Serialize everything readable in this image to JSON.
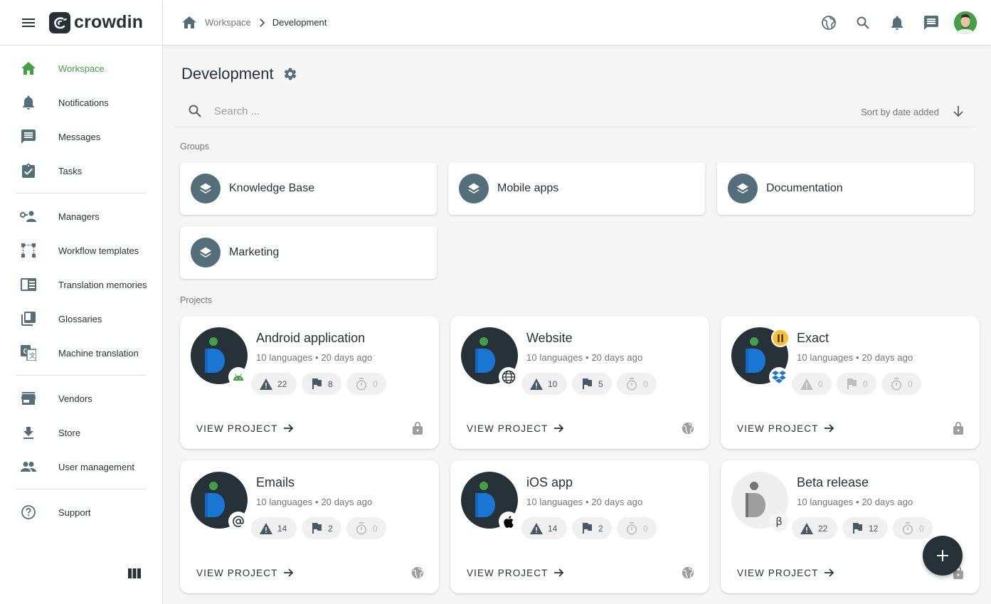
{
  "brand": {
    "name": "crowdin",
    "accent": "#43a047",
    "dark": "#263238"
  },
  "sidebar": {
    "items": [
      {
        "label": "Workspace",
        "icon": "home-icon",
        "active": true
      },
      {
        "label": "Notifications",
        "icon": "bell-icon"
      },
      {
        "label": "Messages",
        "icon": "message-icon"
      },
      {
        "label": "Tasks",
        "icon": "clipboard-check-icon"
      },
      {
        "label": "Managers",
        "icon": "managers-icon"
      },
      {
        "label": "Workflow templates",
        "icon": "workflow-icon"
      },
      {
        "label": "Translation memories",
        "icon": "book-icon"
      },
      {
        "label": "Glossaries",
        "icon": "library-icon"
      },
      {
        "label": "Machine translation",
        "icon": "translate-icon"
      },
      {
        "label": "Vendors",
        "icon": "store-icon"
      },
      {
        "label": "Store",
        "icon": "download-icon"
      },
      {
        "label": "User management",
        "icon": "people-icon"
      },
      {
        "label": "Support",
        "icon": "help-circle-icon"
      }
    ]
  },
  "breadcrumb": {
    "parent": "Workspace",
    "current": "Development"
  },
  "page": {
    "title": "Development"
  },
  "search": {
    "placeholder": "Search ...",
    "sort_label": "Sort by date added"
  },
  "groups_label": "Groups",
  "groups": [
    "Knowledge Base",
    "Mobile apps",
    "Documentation",
    "Marketing"
  ],
  "projects_label": "Projects",
  "projects": [
    {
      "name": "Android application",
      "meta": "10 languages • 20 days ago",
      "issues": "22",
      "flags": "8",
      "pending": "0",
      "platform": "android",
      "visibility": "private"
    },
    {
      "name": "Website",
      "meta": "10 languages • 20 days ago",
      "issues": "10",
      "flags": "5",
      "pending": "0",
      "platform": "web",
      "visibility": "public"
    },
    {
      "name": "Exact",
      "meta": "10 languages • 20 days ago",
      "issues": "0",
      "flags": "0",
      "pending": "0",
      "platform": "dropbox",
      "visibility": "private",
      "paused": true
    },
    {
      "name": "Emails",
      "meta": "10 languages • 20 days ago",
      "issues": "14",
      "flags": "2",
      "pending": "0",
      "platform": "email",
      "visibility": "public"
    },
    {
      "name": "iOS app",
      "meta": "10 languages • 20 days ago",
      "issues": "14",
      "flags": "2",
      "pending": "0",
      "platform": "apple",
      "visibility": "public"
    },
    {
      "name": "Beta release",
      "meta": "10 languages • 20 days ago",
      "issues": "22",
      "flags": "12",
      "pending": "0",
      "platform": "beta",
      "visibility": "private"
    }
  ],
  "view_project_label": "VIEW PROJECT",
  "beta_symbol": "β"
}
